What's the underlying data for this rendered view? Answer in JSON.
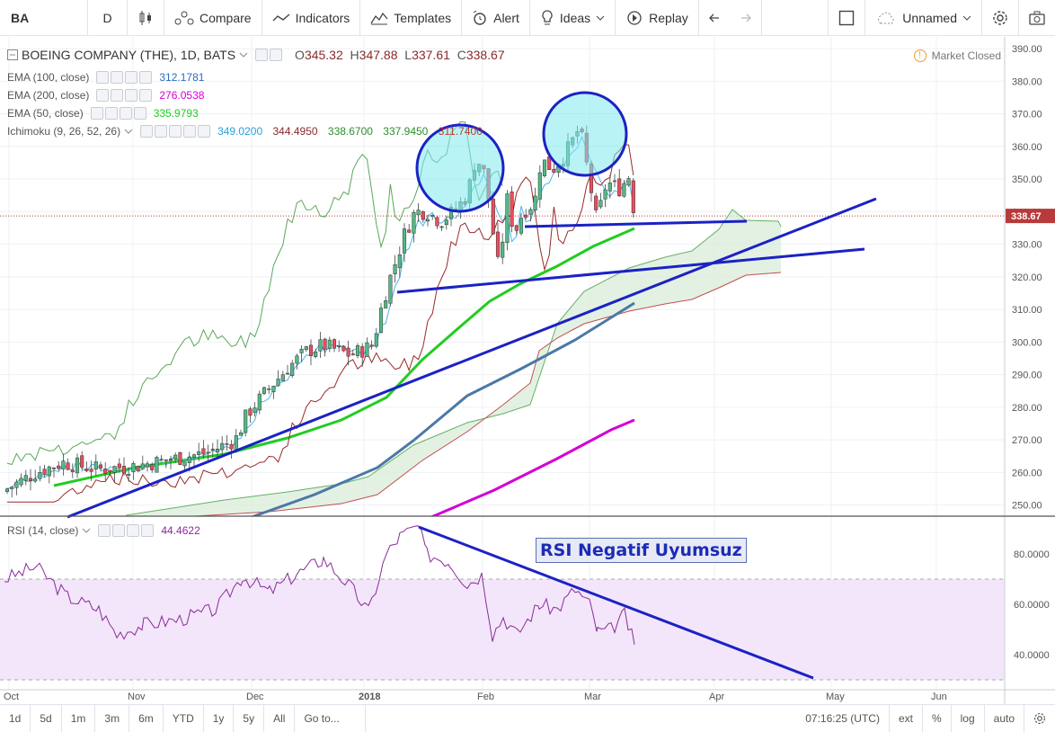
{
  "toolbar": {
    "symbol": "BA",
    "interval": "D",
    "compare": "Compare",
    "indicators": "Indicators",
    "templates": "Templates",
    "alert": "Alert",
    "ideas": "Ideas",
    "replay": "Replay",
    "layout_name": "Unnamed"
  },
  "legend": {
    "title": "BOEING COMPANY (THE), 1D, BATS",
    "open_label": "O",
    "open": "345.32",
    "high_label": "H",
    "high": "347.88",
    "low_label": "L",
    "low": "337.61",
    "close_label": "C",
    "close": "338.67",
    "ema100": {
      "label": "EMA (100, close)",
      "value": "312.1781",
      "color": "#2d6cc0"
    },
    "ema200": {
      "label": "EMA (200, close)",
      "value": "276.0538",
      "color": "#d400d4"
    },
    "ema50": {
      "label": "EMA (50, close)",
      "value": "335.9793",
      "color": "#22cc22"
    },
    "ichimoku": {
      "label": "Ichimoku (9, 26, 52, 26)",
      "v1": "349.0200",
      "v2": "344.4950",
      "v3": "338.6700",
      "v4": "337.9450",
      "v5": "311.7400"
    },
    "rsi": {
      "label": "RSI (14, close)",
      "value": "44.4622"
    }
  },
  "market_status": "Market Closed",
  "price_axis": [
    "390.00",
    "380.00",
    "370.00",
    "360.00",
    "350.00",
    "340.00",
    "330.00",
    "320.00",
    "310.00",
    "300.00",
    "290.00",
    "280.00",
    "270.00",
    "260.00",
    "250.00"
  ],
  "current_price": "338.67",
  "rsi_axis": [
    "80.0000",
    "60.0000",
    "40.0000"
  ],
  "time_axis": [
    "Oct",
    "Nov",
    "Dec",
    "2018",
    "Feb",
    "Mar",
    "Apr",
    "May",
    "Jun"
  ],
  "annotation": "RSI Negatif Uyumsuz",
  "bottom_bar": {
    "ranges": [
      "1d",
      "5d",
      "1m",
      "3m",
      "6m",
      "YTD",
      "1y",
      "5y",
      "All",
      "Go to..."
    ],
    "time": "07:16:25 (UTC)",
    "options": [
      "ext",
      "%",
      "log",
      "auto"
    ]
  },
  "colors": {
    "up": "#53b987",
    "down": "#eb4d5c",
    "trend": "#1b22c4",
    "rsi_line": "#8a2a9a",
    "cloud": "#d9ecd9"
  }
}
